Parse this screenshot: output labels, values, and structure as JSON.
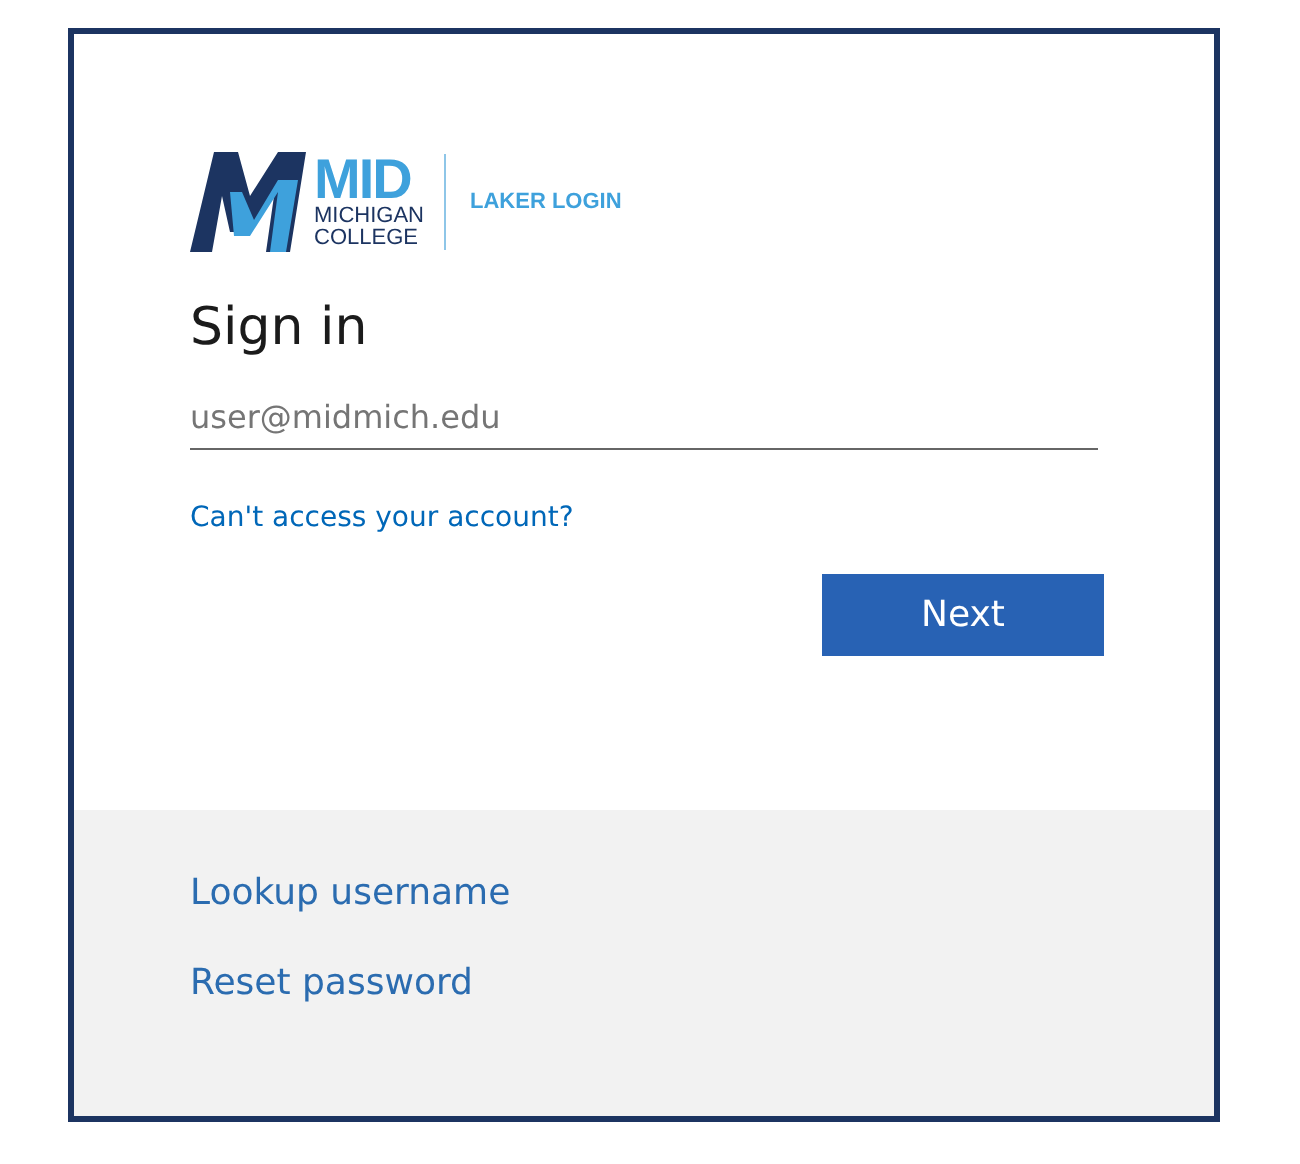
{
  "logo": {
    "mid": "MID",
    "michigan": "MICHIGAN",
    "college": "COLLEGE",
    "tagline": "LAKER LOGIN"
  },
  "title": "Sign in",
  "email_field": {
    "placeholder": "user@midmich.edu"
  },
  "access_link": "Can't access your account?",
  "next_button": "Next",
  "footer_links": [
    "Lookup username",
    "Reset password"
  ]
}
